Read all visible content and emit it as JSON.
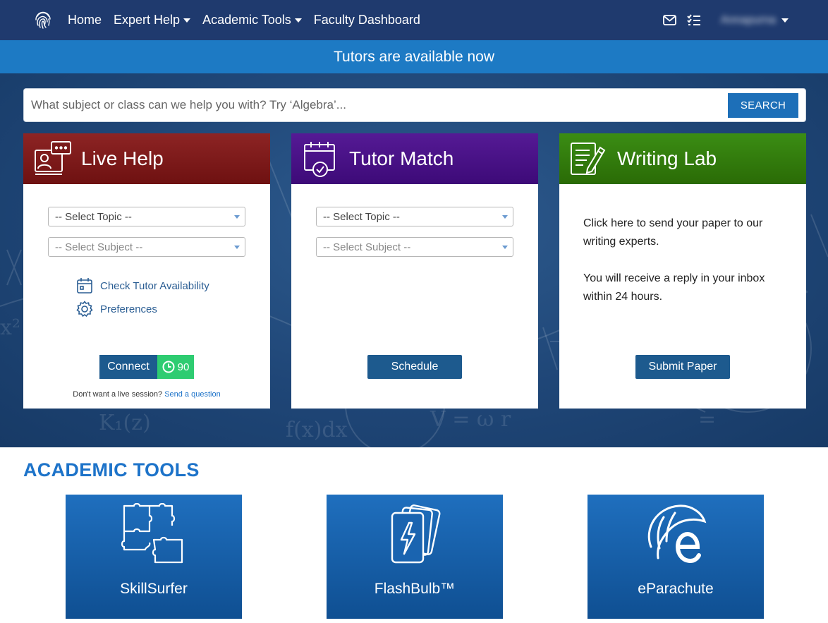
{
  "nav": {
    "links": [
      {
        "label": "Home",
        "dropdown": false
      },
      {
        "label": "Expert Help",
        "dropdown": true
      },
      {
        "label": "Academic Tools",
        "dropdown": true
      },
      {
        "label": "Faculty Dashboard",
        "dropdown": false
      }
    ],
    "user_name": "Annapurna",
    "icons": [
      "fingerprint-logo-icon",
      "envelope-icon",
      "checklist-icon"
    ]
  },
  "banner": {
    "text": "Tutors are available now"
  },
  "search": {
    "placeholder": "What subject or class can we help you with? Try ‘Algebra’...",
    "button": "SEARCH"
  },
  "cards": {
    "live_help": {
      "title": "Live Help",
      "topic": "-- Select Topic --",
      "subject": "-- Select Subject --",
      "availability": "Check Tutor Availability",
      "preferences": "Preferences",
      "connect": "Connect",
      "count": "90",
      "note": "Don't want a live session?",
      "note_link": "Send a question"
    },
    "tutor_match": {
      "title": "Tutor Match",
      "topic": "-- Select Topic --",
      "subject": "-- Select Subject --",
      "button": "Schedule"
    },
    "writing_lab": {
      "title": "Writing Lab",
      "text1": "Click here to send your paper to our writing experts.",
      "text2": "You will receive a reply in your inbox within 24 hours.",
      "button": "Submit Paper"
    }
  },
  "tools": {
    "title": "ACADEMIC TOOLS",
    "items": [
      {
        "label": "SkillSurfer",
        "icon": "puzzle-icon"
      },
      {
        "label": "FlashBulb™",
        "icon": "flashcards-icon"
      },
      {
        "label": "eParachute",
        "icon": "eparachute-icon"
      }
    ]
  },
  "colors": {
    "navbar": "#1f3a6e",
    "banner": "#1d7ac4",
    "live_help": "#7a1a1a",
    "tutor_match": "#4a0f87",
    "writing_lab": "#327c0c",
    "accent": "#1d73c9",
    "count_badge": "#2ecc71"
  }
}
